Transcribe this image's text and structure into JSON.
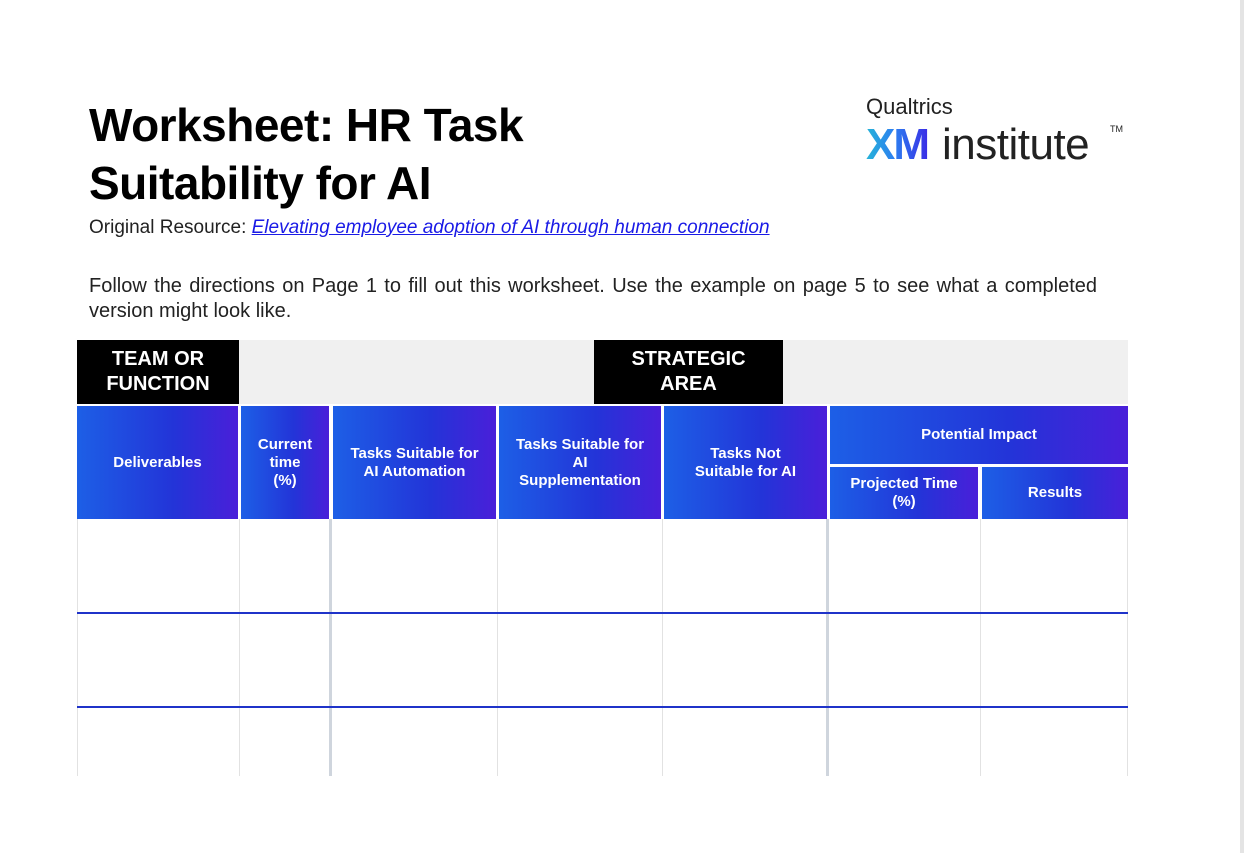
{
  "title": {
    "line1": "Worksheet: HR Task",
    "line2": "Suitability for AI"
  },
  "resource": {
    "label": "Original Resource:",
    "link_text": "Elevating employee adoption of AI through human connection"
  },
  "logo": {
    "brand": "Qualtrics",
    "xm": "XM",
    "institute": "institute",
    "tm": "TM"
  },
  "directions": "Follow the directions on Page 1 to fill out this worksheet. Use the example on page 5 to see what a completed version might look like.",
  "table": {
    "team_label": "TEAM OR\nFUNCTION",
    "strategic_label": "STRATEGIC\nAREA",
    "headers": {
      "deliverables": "Deliverables",
      "current_time": "Current\ntime\n(%)",
      "automation_pre": "Tasks  Suitable for\nAI ",
      "automation_bold": "Automation",
      "supplementation_pre": "Tasks Suitable for\nAI\n",
      "supplementation_bold": "Supplementation",
      "not_pre": "Tasks ",
      "not_bold": "Not",
      "not_bold2": "Suitable",
      "not_post": " for AI",
      "potential_impact": "Potential Impact",
      "projected_time": "Projected Time\n(%)",
      "results": "Results"
    },
    "rows": [
      [
        "",
        "",
        "",
        "",
        "",
        "",
        ""
      ],
      [
        "",
        "",
        "",
        "",
        "",
        "",
        ""
      ],
      [
        "",
        "",
        "",
        "",
        "",
        "",
        ""
      ]
    ]
  },
  "colors": {
    "accent_blue": "#1f33c9",
    "header_gradient_start": "#1d5fe6",
    "header_gradient_end": "#4a1fd9",
    "logo_gradient_start": "#27b4d8",
    "logo_gradient_end": "#3a2de6"
  }
}
